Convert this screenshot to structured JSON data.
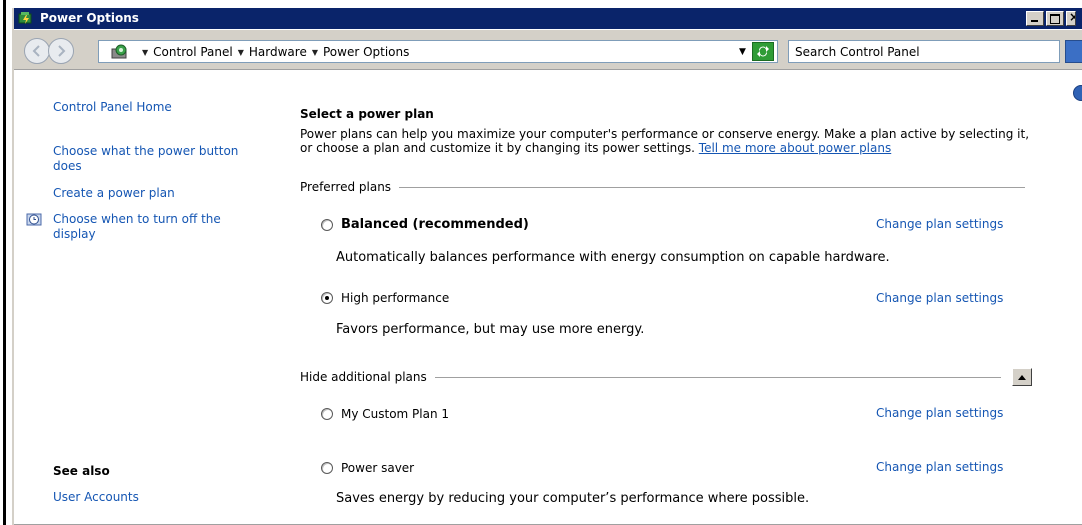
{
  "window": {
    "title": "Power Options"
  },
  "address_bar": {
    "breadcrumbs": [
      {
        "label": "Control Panel"
      },
      {
        "label": "Hardware"
      },
      {
        "label": "Power Options"
      }
    ],
    "search_placeholder": "Search Control Panel"
  },
  "sidebar": {
    "home_link": "Control Panel Home",
    "links": [
      {
        "label": "Choose what the power button does"
      },
      {
        "label": "Create a power plan"
      },
      {
        "label": "Choose when to turn off the display",
        "icon": "display-clock-icon"
      }
    ],
    "see_also_heading": "See also",
    "see_also_links": [
      {
        "label": "User Accounts"
      }
    ]
  },
  "main": {
    "title": "Select a power plan",
    "description": "Power plans can help you maximize your computer's performance or conserve energy. Make a plan active by selecting it, or choose a plan and customize it by changing its power settings.",
    "more_link": "Tell me more about power plans",
    "preferred_heading": "Preferred plans",
    "additional_heading": "Hide additional plans",
    "change_label": "Change plan settings",
    "plans": [
      {
        "name": "Balanced (recommended)",
        "description": "Automatically balances performance with energy consumption on capable hardware.",
        "selected": false,
        "bold": true
      },
      {
        "name": "High performance",
        "description": "Favors performance, but may use more energy.",
        "selected": true,
        "bold": false
      },
      {
        "name": "My Custom Plan 1",
        "description": "",
        "selected": false,
        "bold": false
      },
      {
        "name": "Power saver",
        "description": "Saves energy by reducing your computer’s performance where possible.",
        "selected": false,
        "bold": false
      }
    ]
  },
  "colors": {
    "titlebar": "#0a246a",
    "link": "#1556b3",
    "chrome": "#d4d0c8"
  }
}
